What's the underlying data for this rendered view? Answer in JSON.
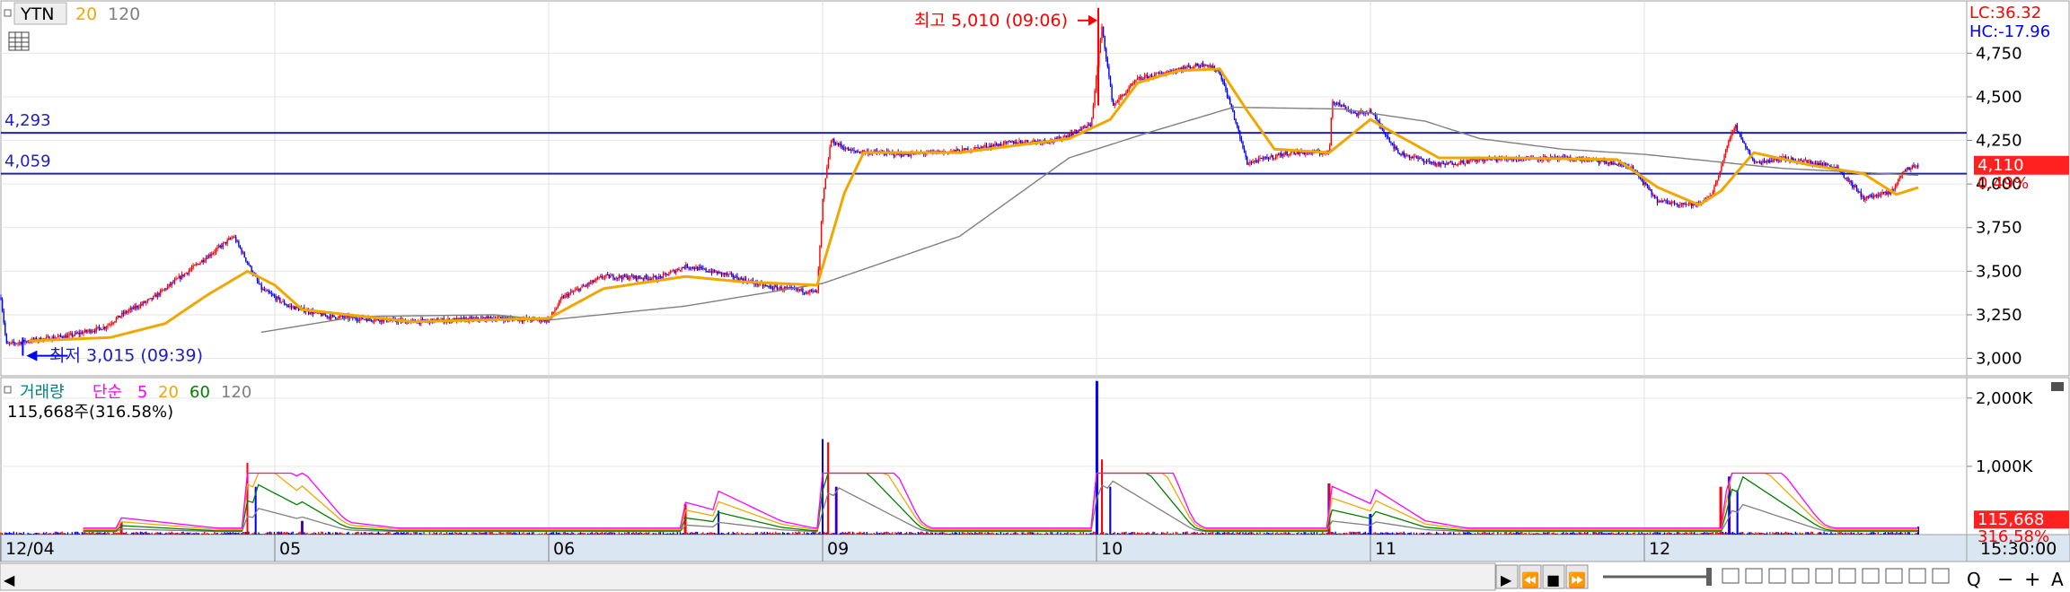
{
  "header": {
    "symbol": "YTN",
    "ma_a": "20",
    "ma_b": "120",
    "lc": "LC:36.32",
    "hc": "HC:-17.96"
  },
  "price_panel": {
    "ylim": [
      2900,
      5050
    ],
    "ticks": [
      "4,750",
      "4,500",
      "4,250",
      "4,000",
      "3,750",
      "3,500",
      "3,250",
      "3,000"
    ],
    "tick_values": [
      4750,
      4500,
      4250,
      4000,
      3750,
      3500,
      3250,
      3000
    ],
    "hlines": [
      {
        "label": "4,293",
        "value": 4293
      },
      {
        "label": "4,059",
        "value": 4059
      }
    ],
    "high_annotation": "최고 5,010 (09:06)",
    "high_value": 5010,
    "low_annotation": "최저 3,015 (09:39)",
    "low_value": 3015,
    "current_price": "4,110",
    "current_value": 4110,
    "current_change": "0.49%"
  },
  "volume_panel": {
    "legend": {
      "label": "거래량",
      "ma_prefix": "단순",
      "ma1": "5",
      "ma2": "20",
      "ma3": "60",
      "ma4": "120"
    },
    "info": "115,668주(316.58%)",
    "ylim": [
      0,
      2300
    ],
    "ticks": [
      "2,000K",
      "1,000K"
    ],
    "tick_values": [
      2000,
      1000
    ],
    "current_volume": "115,668",
    "current_volume_value": 115.668,
    "current_pct": "316.58%"
  },
  "x_axis": {
    "labels": [
      "12/04",
      "05",
      "06",
      "09",
      "10",
      "11",
      "12"
    ],
    "time_label": "15:30:00"
  },
  "colors": {
    "up": "#ff0000",
    "down": "#0000ff",
    "ma20": "#f0a800",
    "ma120": "#808080",
    "hline": "#2020c0",
    "vol_ma5": "#ff00ff",
    "vol_ma20": "#f0a800",
    "vol_ma60": "#008000",
    "vol_ma120": "#808080"
  },
  "chart_data": {
    "type": "candlestick",
    "days": [
      "12/04",
      "05",
      "06",
      "09",
      "10",
      "11",
      "12"
    ],
    "price_close_path": [
      {
        "t": 0.0,
        "v": 3350
      },
      {
        "t": 0.02,
        "v": 3080
      },
      {
        "t": 0.1,
        "v": 3100
      },
      {
        "t": 0.25,
        "v": 3130
      },
      {
        "t": 0.38,
        "v": 3180
      },
      {
        "t": 0.45,
        "v": 3260
      },
      {
        "t": 0.5,
        "v": 3300
      },
      {
        "t": 0.55,
        "v": 3340
      },
      {
        "t": 0.85,
        "v": 3700
      },
      {
        "t": 0.95,
        "v": 3400
      },
      {
        "t": 1.05,
        "v": 3300
      },
      {
        "t": 1.2,
        "v": 3240
      },
      {
        "t": 1.5,
        "v": 3210
      },
      {
        "t": 1.8,
        "v": 3230
      },
      {
        "t": 2.0,
        "v": 3220
      },
      {
        "t": 2.05,
        "v": 3350
      },
      {
        "t": 2.2,
        "v": 3470
      },
      {
        "t": 2.4,
        "v": 3460
      },
      {
        "t": 2.5,
        "v": 3530
      },
      {
        "t": 2.65,
        "v": 3480
      },
      {
        "t": 2.8,
        "v": 3410
      },
      {
        "t": 2.98,
        "v": 3380
      },
      {
        "t": 3.0,
        "v": 3900
      },
      {
        "t": 3.03,
        "v": 4250
      },
      {
        "t": 3.1,
        "v": 4190
      },
      {
        "t": 3.3,
        "v": 4170
      },
      {
        "t": 3.5,
        "v": 4190
      },
      {
        "t": 3.7,
        "v": 4240
      },
      {
        "t": 3.85,
        "v": 4250
      },
      {
        "t": 3.98,
        "v": 4340
      },
      {
        "t": 4.0,
        "v": 4620
      },
      {
        "t": 4.02,
        "v": 4900
      },
      {
        "t": 4.06,
        "v": 4450
      },
      {
        "t": 4.15,
        "v": 4600
      },
      {
        "t": 4.3,
        "v": 4660
      },
      {
        "t": 4.4,
        "v": 4690
      },
      {
        "t": 4.45,
        "v": 4640
      },
      {
        "t": 4.5,
        "v": 4400
      },
      {
        "t": 4.55,
        "v": 4120
      },
      {
        "t": 4.7,
        "v": 4180
      },
      {
        "t": 4.85,
        "v": 4180
      },
      {
        "t": 4.86,
        "v": 4480
      },
      {
        "t": 4.95,
        "v": 4400
      },
      {
        "t": 5.0,
        "v": 4420
      },
      {
        "t": 5.1,
        "v": 4180
      },
      {
        "t": 5.25,
        "v": 4110
      },
      {
        "t": 5.4,
        "v": 4140
      },
      {
        "t": 5.6,
        "v": 4150
      },
      {
        "t": 5.8,
        "v": 4140
      },
      {
        "t": 5.95,
        "v": 4100
      },
      {
        "t": 6.05,
        "v": 3900
      },
      {
        "t": 6.2,
        "v": 3880
      },
      {
        "t": 6.25,
        "v": 3950
      },
      {
        "t": 6.3,
        "v": 4200
      },
      {
        "t": 6.33,
        "v": 4340
      },
      {
        "t": 6.4,
        "v": 4120
      },
      {
        "t": 6.5,
        "v": 4150
      },
      {
        "t": 6.7,
        "v": 4100
      },
      {
        "t": 6.8,
        "v": 3920
      },
      {
        "t": 6.9,
        "v": 3950
      },
      {
        "t": 6.95,
        "v": 4080
      },
      {
        "t": 7.0,
        "v": 4110
      }
    ],
    "ma20_path": [
      {
        "t": 0.1,
        "v": 3100
      },
      {
        "t": 0.4,
        "v": 3120
      },
      {
        "t": 0.6,
        "v": 3200
      },
      {
        "t": 0.75,
        "v": 3360
      },
      {
        "t": 0.9,
        "v": 3500
      },
      {
        "t": 1.0,
        "v": 3420
      },
      {
        "t": 1.1,
        "v": 3280
      },
      {
        "t": 1.5,
        "v": 3210
      },
      {
        "t": 2.0,
        "v": 3230
      },
      {
        "t": 2.2,
        "v": 3400
      },
      {
        "t": 2.5,
        "v": 3470
      },
      {
        "t": 2.7,
        "v": 3440
      },
      {
        "t": 2.98,
        "v": 3420
      },
      {
        "t": 3.08,
        "v": 3950
      },
      {
        "t": 3.15,
        "v": 4180
      },
      {
        "t": 3.5,
        "v": 4180
      },
      {
        "t": 3.9,
        "v": 4260
      },
      {
        "t": 4.05,
        "v": 4370
      },
      {
        "t": 4.15,
        "v": 4580
      },
      {
        "t": 4.3,
        "v": 4650
      },
      {
        "t": 4.45,
        "v": 4660
      },
      {
        "t": 4.55,
        "v": 4420
      },
      {
        "t": 4.65,
        "v": 4200
      },
      {
        "t": 4.85,
        "v": 4180
      },
      {
        "t": 5.0,
        "v": 4370
      },
      {
        "t": 5.1,
        "v": 4280
      },
      {
        "t": 5.25,
        "v": 4150
      },
      {
        "t": 5.5,
        "v": 4150
      },
      {
        "t": 5.9,
        "v": 4140
      },
      {
        "t": 6.05,
        "v": 3980
      },
      {
        "t": 6.2,
        "v": 3880
      },
      {
        "t": 6.28,
        "v": 3960
      },
      {
        "t": 6.4,
        "v": 4180
      },
      {
        "t": 6.6,
        "v": 4110
      },
      {
        "t": 6.8,
        "v": 4060
      },
      {
        "t": 6.92,
        "v": 3940
      },
      {
        "t": 7.0,
        "v": 3980
      }
    ],
    "ma120_path": [
      {
        "t": 0.95,
        "v": 3150
      },
      {
        "t": 1.3,
        "v": 3240
      },
      {
        "t": 1.8,
        "v": 3250
      },
      {
        "t": 2.0,
        "v": 3220
      },
      {
        "t": 2.5,
        "v": 3300
      },
      {
        "t": 3.0,
        "v": 3430
      },
      {
        "t": 3.5,
        "v": 3700
      },
      {
        "t": 3.9,
        "v": 4150
      },
      {
        "t": 4.2,
        "v": 4300
      },
      {
        "t": 4.5,
        "v": 4440
      },
      {
        "t": 4.9,
        "v": 4430
      },
      {
        "t": 5.2,
        "v": 4360
      },
      {
        "t": 5.4,
        "v": 4260
      },
      {
        "t": 5.7,
        "v": 4200
      },
      {
        "t": 6.0,
        "v": 4170
      },
      {
        "t": 6.5,
        "v": 4090
      },
      {
        "t": 7.0,
        "v": 4050
      }
    ],
    "volume_spikes": [
      {
        "t": 0.44,
        "v": 180
      },
      {
        "t": 0.9,
        "v": 1050
      },
      {
        "t": 0.93,
        "v": 700
      },
      {
        "t": 1.1,
        "v": 200
      },
      {
        "t": 2.5,
        "v": 450
      },
      {
        "t": 2.62,
        "v": 350
      },
      {
        "t": 3.0,
        "v": 1400
      },
      {
        "t": 3.02,
        "v": 1350
      },
      {
        "t": 3.05,
        "v": 700
      },
      {
        "t": 4.0,
        "v": 2250
      },
      {
        "t": 4.02,
        "v": 1100
      },
      {
        "t": 4.05,
        "v": 700
      },
      {
        "t": 4.85,
        "v": 750
      },
      {
        "t": 5.0,
        "v": 300
      },
      {
        "t": 6.28,
        "v": 700
      },
      {
        "t": 6.31,
        "v": 850
      },
      {
        "t": 6.34,
        "v": 650
      },
      {
        "t": 7.0,
        "v": 116
      }
    ]
  },
  "scrollbar": {
    "left_arrow": "◀",
    "buttons": [
      "▶",
      "⏪",
      "■",
      "⏩"
    ],
    "tool_labels": [
      "Q",
      "−",
      "+",
      "A"
    ]
  }
}
